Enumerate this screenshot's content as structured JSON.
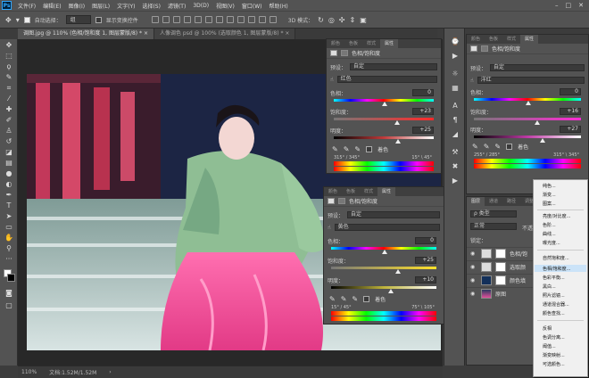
{
  "menubar": {
    "logo": "Ps",
    "items": [
      "文件(F)",
      "编辑(E)",
      "图像(I)",
      "图层(L)",
      "文字(Y)",
      "选择(S)",
      "滤镜(T)",
      "3D(D)",
      "视图(V)",
      "窗口(W)",
      "帮助(H)"
    ],
    "controls": [
      "–",
      "□",
      "✕"
    ]
  },
  "options": {
    "auto_select_label": "自动选择：",
    "auto_select_value": "组",
    "show_transform_label": "显示变换控件",
    "mode_3d_label": "3D 模式："
  },
  "tabs": [
    {
      "label": "调图.jpg @ 110% (色相/饱和度 1, 图层蒙版/8) * ×"
    },
    {
      "label": "人像调色 psd @ 100% (选取颜色 1, 图层蒙版/8) * ×"
    }
  ],
  "status": {
    "zoom": "110%",
    "doc_info": "文档:1.52M/1.52M"
  },
  "props1": {
    "tabs": [
      "颜色",
      "色板",
      "样式",
      "属性"
    ],
    "title": "色相/饱和度",
    "preset_label": "预设：",
    "preset_value": "自定",
    "channel_value": "红色",
    "hue_label": "色相：",
    "hue_value": "0",
    "sat_label": "饱和度：",
    "sat_value": "+23",
    "light_label": "明度：",
    "light_value": "+25",
    "colorize_label": "着色",
    "range_left": "315° / 345°",
    "range_right": "15° \\ 45°"
  },
  "props2": {
    "tabs": [
      "颜色",
      "色板",
      "样式",
      "属性"
    ],
    "title": "色相/饱和度",
    "preset_label": "预设：",
    "preset_value": "自定",
    "channel_value": "黄色",
    "hue_label": "色相：",
    "hue_value": "0",
    "sat_label": "饱和度：",
    "sat_value": "+25",
    "light_label": "明度：",
    "light_value": "+10",
    "colorize_label": "着色",
    "range_left": "15° / 45°",
    "range_right": "75° \\ 105°"
  },
  "props3": {
    "tabs": [
      "颜色",
      "色板",
      "样式",
      "属性"
    ],
    "title": "色相/饱和度",
    "preset_label": "预设：",
    "preset_value": "自定",
    "channel_value": "洋红",
    "hue_label": "色相：",
    "hue_value": "0",
    "sat_label": "饱和度：",
    "sat_value": "+16",
    "light_label": "明度：",
    "light_value": "+27",
    "colorize_label": "着色",
    "range_left": "255° / 285°",
    "range_right": "315° \\ 345°"
  },
  "layers": {
    "tabs": [
      "图层",
      "通道",
      "路径",
      "调整"
    ],
    "filter_label": "ρ 类型",
    "blend_mode": "正常",
    "opacity_label": "不透明",
    "lock_label": "锁定：",
    "rows": [
      {
        "name": "色相/饱"
      },
      {
        "name": "选取颜"
      },
      {
        "name": "颜色填"
      },
      {
        "name": "原图"
      }
    ]
  },
  "context_menu": {
    "items": [
      "纯色...",
      "渐变...",
      "图案...",
      "亮度/对比度...",
      "色阶...",
      "曲线...",
      "曝光度...",
      "自然饱和度...",
      "色相/饱和度...",
      "色彩平衡...",
      "黑白...",
      "照片滤镜...",
      "通道混合器...",
      "颜色查找...",
      "反相",
      "色调分离...",
      "阈值...",
      "渐变映射...",
      "可选颜色..."
    ],
    "highlighted": "色相/饱和度..."
  }
}
